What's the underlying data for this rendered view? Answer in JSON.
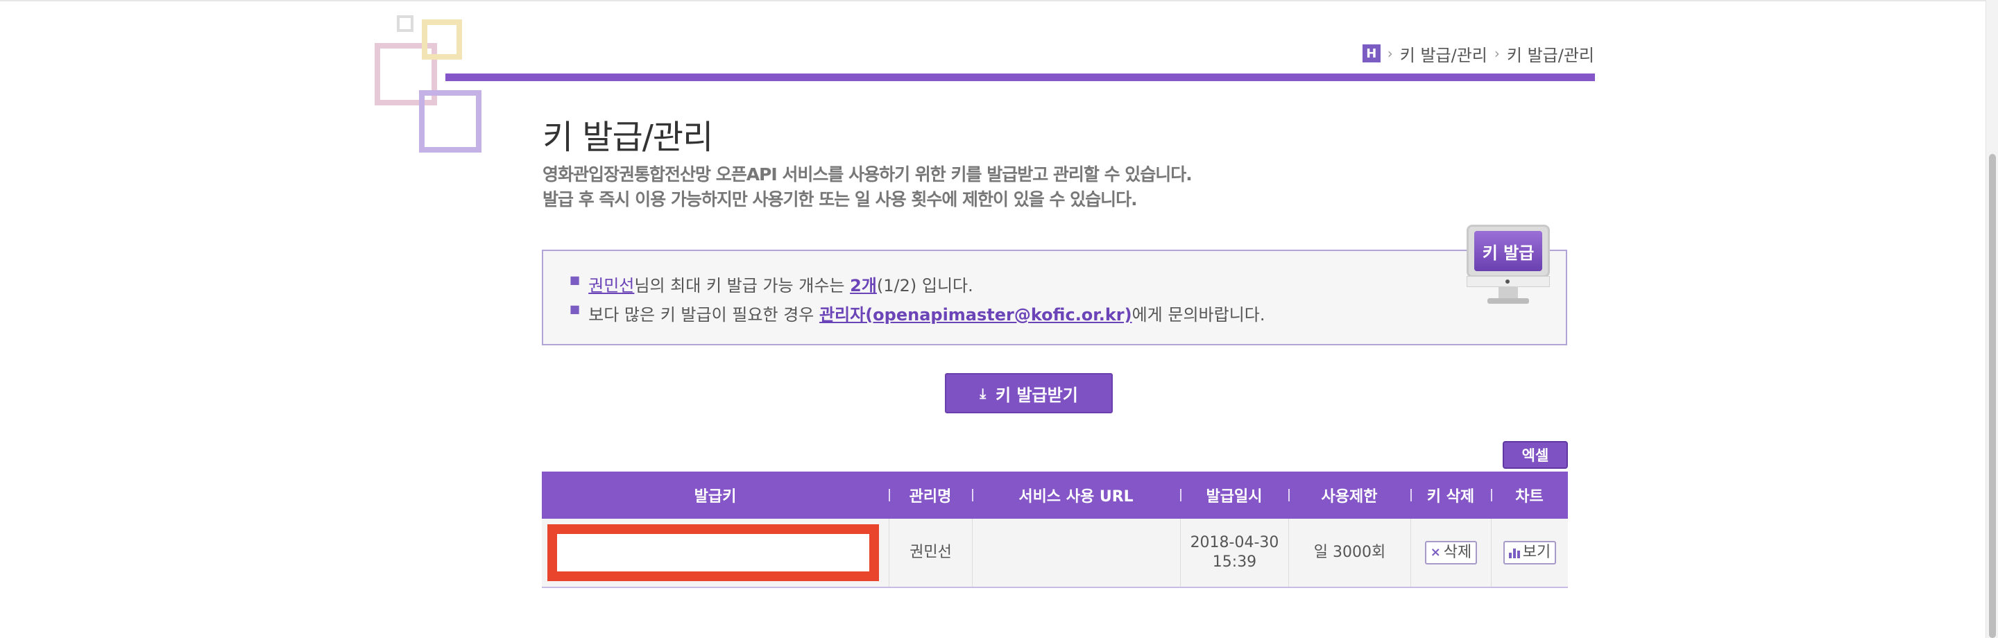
{
  "breadcrumb": {
    "home_label": "H",
    "items": [
      "키 발급/관리",
      "키 발급/관리"
    ]
  },
  "page": {
    "title": "키 발급/관리",
    "desc_line1": "영화관입장권통합전산망 오픈API 서비스를 사용하기 위한 키를 발급받고 관리할 수 있습니다.",
    "desc_line2": "발급 후 즉시 이용 가능하지만 사용기한 또는 일 사용 횟수에 제한이 있을 수 있습니다."
  },
  "info": {
    "line1_user": "권민선",
    "line1_mid": "님의 최대 키 발급 가능 개수는 ",
    "line1_count": "2개",
    "line1_end": "(1/2) 입니다.",
    "line2_start": "보다 많은 키 발급이 필요한 경우 ",
    "line2_link": "관리자(openapimaster@kofic.or.kr)",
    "line2_end": "에게 문의바랍니다."
  },
  "monitor_label": "키 발급",
  "issue_button_label": "키 발급받기",
  "excel_button_label": "엑셀",
  "table": {
    "headers": [
      "발급키",
      "관리명",
      "서비스 사용 URL",
      "발급일시",
      "사용제한",
      "키 삭제",
      "차트"
    ],
    "rows": [
      {
        "manager": "권민선",
        "service_url": "",
        "issued_date": "2018-04-30",
        "issued_time": "15:39",
        "limit": "일 3000회",
        "delete_label": "삭제",
        "chart_label": "보기"
      }
    ]
  },
  "colors": {
    "accent": "#8456c7",
    "redaction": "#e8452c"
  }
}
